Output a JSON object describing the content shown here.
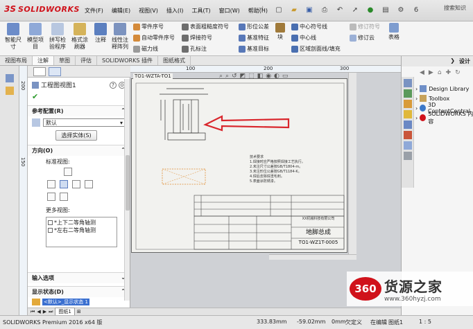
{
  "app": {
    "brand_ds": "3S",
    "brand_sw": "SOLIDWORKS"
  },
  "menu": [
    "文件(F)",
    "编辑(E)",
    "视图(V)",
    "插入(I)",
    "工具(T)",
    "窗口(W)",
    "帮助(H)"
  ],
  "search_hint": "搜索知识",
  "qat_extra": "6",
  "ribbon": {
    "smart_dim": "智能尺寸",
    "model_items": "模型项目",
    "spell_check": "拼写检验程序",
    "format_painter": "格式涂刷器",
    "note": "注释",
    "linear_pattern": "线性注释阵列",
    "balloon": "零件序号",
    "auto_balloon": "自动零件序号",
    "magnetic_line": "磁力线",
    "surface_finish": "表面粗糙度符号",
    "weld_symbol": "焊接符号",
    "hole_callout": "孔标注",
    "gtol": "形位公差",
    "datum_feature": "基准特征",
    "datum_target": "基准目标",
    "block": "块",
    "center_mark": "中心符号线",
    "centerline": "中心线",
    "area_hatch": "区域剖面线/填充",
    "revision_symbol": "修订符号",
    "revision_cloud": "修订云",
    "table": "表格"
  },
  "tabs": [
    "视图布局",
    "注解",
    "草图",
    "评估",
    "SOLIDWORKS 插件",
    "图纸格式"
  ],
  "ruler": {
    "h1": "100",
    "h2": "200",
    "h3": "300",
    "v1": "200",
    "v2": "150"
  },
  "property_manager": {
    "title": "工程图视图1",
    "ref_config_label": "参考配置(R)",
    "ref_config_value": "默认",
    "select_bodies": "选择实体(S)",
    "orientation_label": "方向(O)",
    "standard_views": "标准视图:",
    "more_views": "更多视图:",
    "more_view_items": [
      "*上下二等角轴测",
      "*左右二等角轴测"
    ],
    "import_options": "输入选项",
    "display_state": "显示状态(D)",
    "display_state_value": "<默认>_显示状态 1"
  },
  "sheet": {
    "drawing_no_rotated": "TO1-WZTA-TO1",
    "title_name": "地脚总成",
    "drawing_code": "TO1-WZ1T-0005",
    "company": "XX机械科技有限公司",
    "notes_heading": "技术要求",
    "notes": [
      "1.焊接时应严格按照焊接工艺执行。",
      "2.未注尺寸公差按GB/T1804-m。",
      "3.未注形位公差按GB/T1184-K。",
      "4.焊后去除焊渣毛刺。",
      "5.表面涂防锈漆。"
    ]
  },
  "task_pane": {
    "title": "设计",
    "items": [
      "Design Library",
      "Toolbox",
      "3D ContentCentral",
      "SOLIDWORKS 内容"
    ]
  },
  "bottom_tabs": [
    "图纸1"
  ],
  "status": {
    "product": "SOLIDWORKS Premium 2016 x64 版",
    "x": "333.83mm",
    "y": "-59.02mm",
    "z": "0mm",
    "define_state": "欠定义",
    "edit_state": "在编辑",
    "edit_target": "图纸1",
    "scale": "1 : 5"
  },
  "watermark": {
    "logo": "360",
    "text": "货源之家",
    "url": "www.360hyzj.com"
  },
  "colors": {
    "accent_red": "#d0121b",
    "arrow_red": "#d9262c",
    "canvas_bg": "#cfd1d5",
    "sheet_bg": "#f2f2ef"
  }
}
